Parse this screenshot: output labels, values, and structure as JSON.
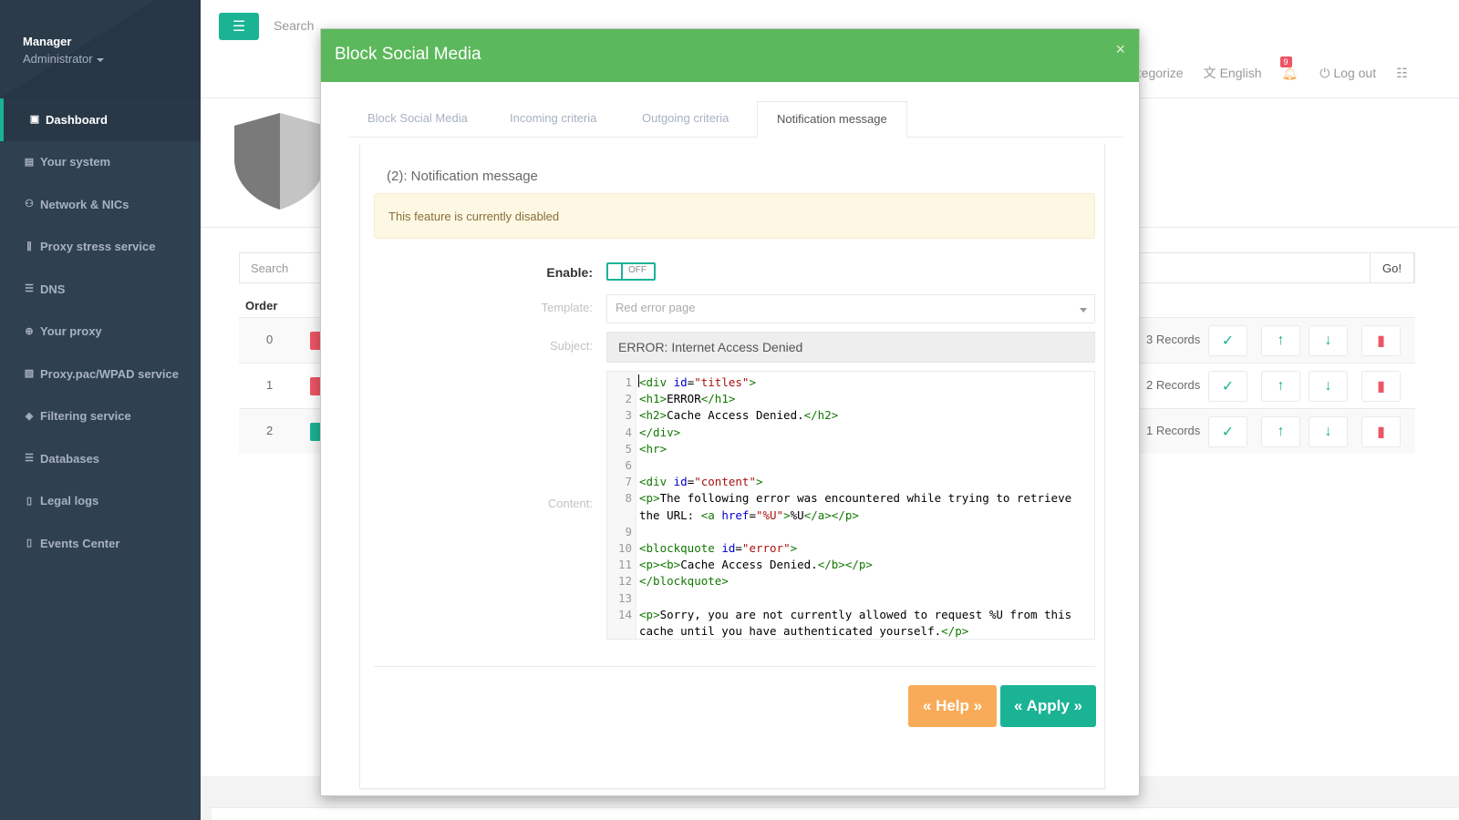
{
  "sidebar": {
    "user": "Manager",
    "role": "Administrator",
    "items": [
      {
        "label": "Dashboard",
        "icon": "dashboard-icon",
        "glyph": "▣"
      },
      {
        "label": "Your system",
        "icon": "server-icon",
        "glyph": "▤"
      },
      {
        "label": "Network & NICs",
        "icon": "network-icon",
        "glyph": "⚇"
      },
      {
        "label": "Proxy stress service",
        "icon": "stress-icon",
        "glyph": "⫼"
      },
      {
        "label": "DNS",
        "icon": "database-icon",
        "glyph": "☰"
      },
      {
        "label": "Your proxy",
        "icon": "globe-icon",
        "glyph": "⊕"
      },
      {
        "label": "Proxy.pac/WPAD service",
        "icon": "script-icon",
        "glyph": "▧"
      },
      {
        "label": "Filtering service",
        "icon": "shield-icon",
        "glyph": "◈"
      },
      {
        "label": "Databases",
        "icon": "database-icon",
        "glyph": "☰"
      },
      {
        "label": "Legal logs",
        "icon": "file-icon",
        "glyph": "▯"
      },
      {
        "label": "Events Center",
        "icon": "file-icon",
        "glyph": "▯"
      }
    ]
  },
  "topbar": {
    "search_placeholder": "Search",
    "categorize": "ategorize",
    "language": "English",
    "notifications": "9",
    "logout": "Log out"
  },
  "list": {
    "search_placeholder": "Search",
    "go_label": "Go!",
    "order_header": "Order",
    "rows": [
      {
        "order": "0",
        "records": "3 Records"
      },
      {
        "order": "1",
        "records": "2 Records"
      },
      {
        "order": "2",
        "records": "1 Records"
      }
    ]
  },
  "colors": {
    "accent": "#1ab394",
    "header_green": "#5cb85c",
    "danger": "#ed5565",
    "warning": "#f8ac59",
    "sidebar": "#2f4050"
  },
  "modal": {
    "title": "Block Social Media",
    "close": "×",
    "tabs": [
      "Block Social Media",
      "Incoming criteria",
      "Outgoing criteria",
      "Notification message"
    ],
    "active_tab": 3,
    "panel_title": "(2): Notification message",
    "alert": "This feature is currently disabled",
    "enable_label": "Enable:",
    "toggle_state": "OFF",
    "template_label": "Template:",
    "template_value": "Red error page",
    "subject_label": "Subject:",
    "subject_value": "ERROR: Internet Access Denied",
    "content_label": "Content:",
    "help_label": "« Help »",
    "apply_label": "« Apply »",
    "code_lines": [
      {
        "n": "1",
        "t": "<div id=\"titles\">"
      },
      {
        "n": "2",
        "t": "<h1>ERROR</h1>"
      },
      {
        "n": "3",
        "t": "<h2>Cache Access Denied.</h2>"
      },
      {
        "n": "4",
        "t": "</div>"
      },
      {
        "n": "5",
        "t": "<hr>"
      },
      {
        "n": "6",
        "t": ""
      },
      {
        "n": "7",
        "t": "<div id=\"content\">"
      },
      {
        "n": "8",
        "t": "<p>The following error was encountered while trying to retrieve"
      },
      {
        "n": "",
        "t": "the URL: <a href=\"%U\">%U</a></p>"
      },
      {
        "n": "9",
        "t": ""
      },
      {
        "n": "10",
        "t": "<blockquote id=\"error\">"
      },
      {
        "n": "11",
        "t": "<p><b>Cache Access Denied.</b></p>"
      },
      {
        "n": "12",
        "t": "</blockquote>"
      },
      {
        "n": "13",
        "t": ""
      },
      {
        "n": "14",
        "t": "<p>Sorry, you are not currently allowed to request %U from this"
      },
      {
        "n": "",
        "t": "cache until you have authenticated yourself.</p>"
      }
    ]
  }
}
